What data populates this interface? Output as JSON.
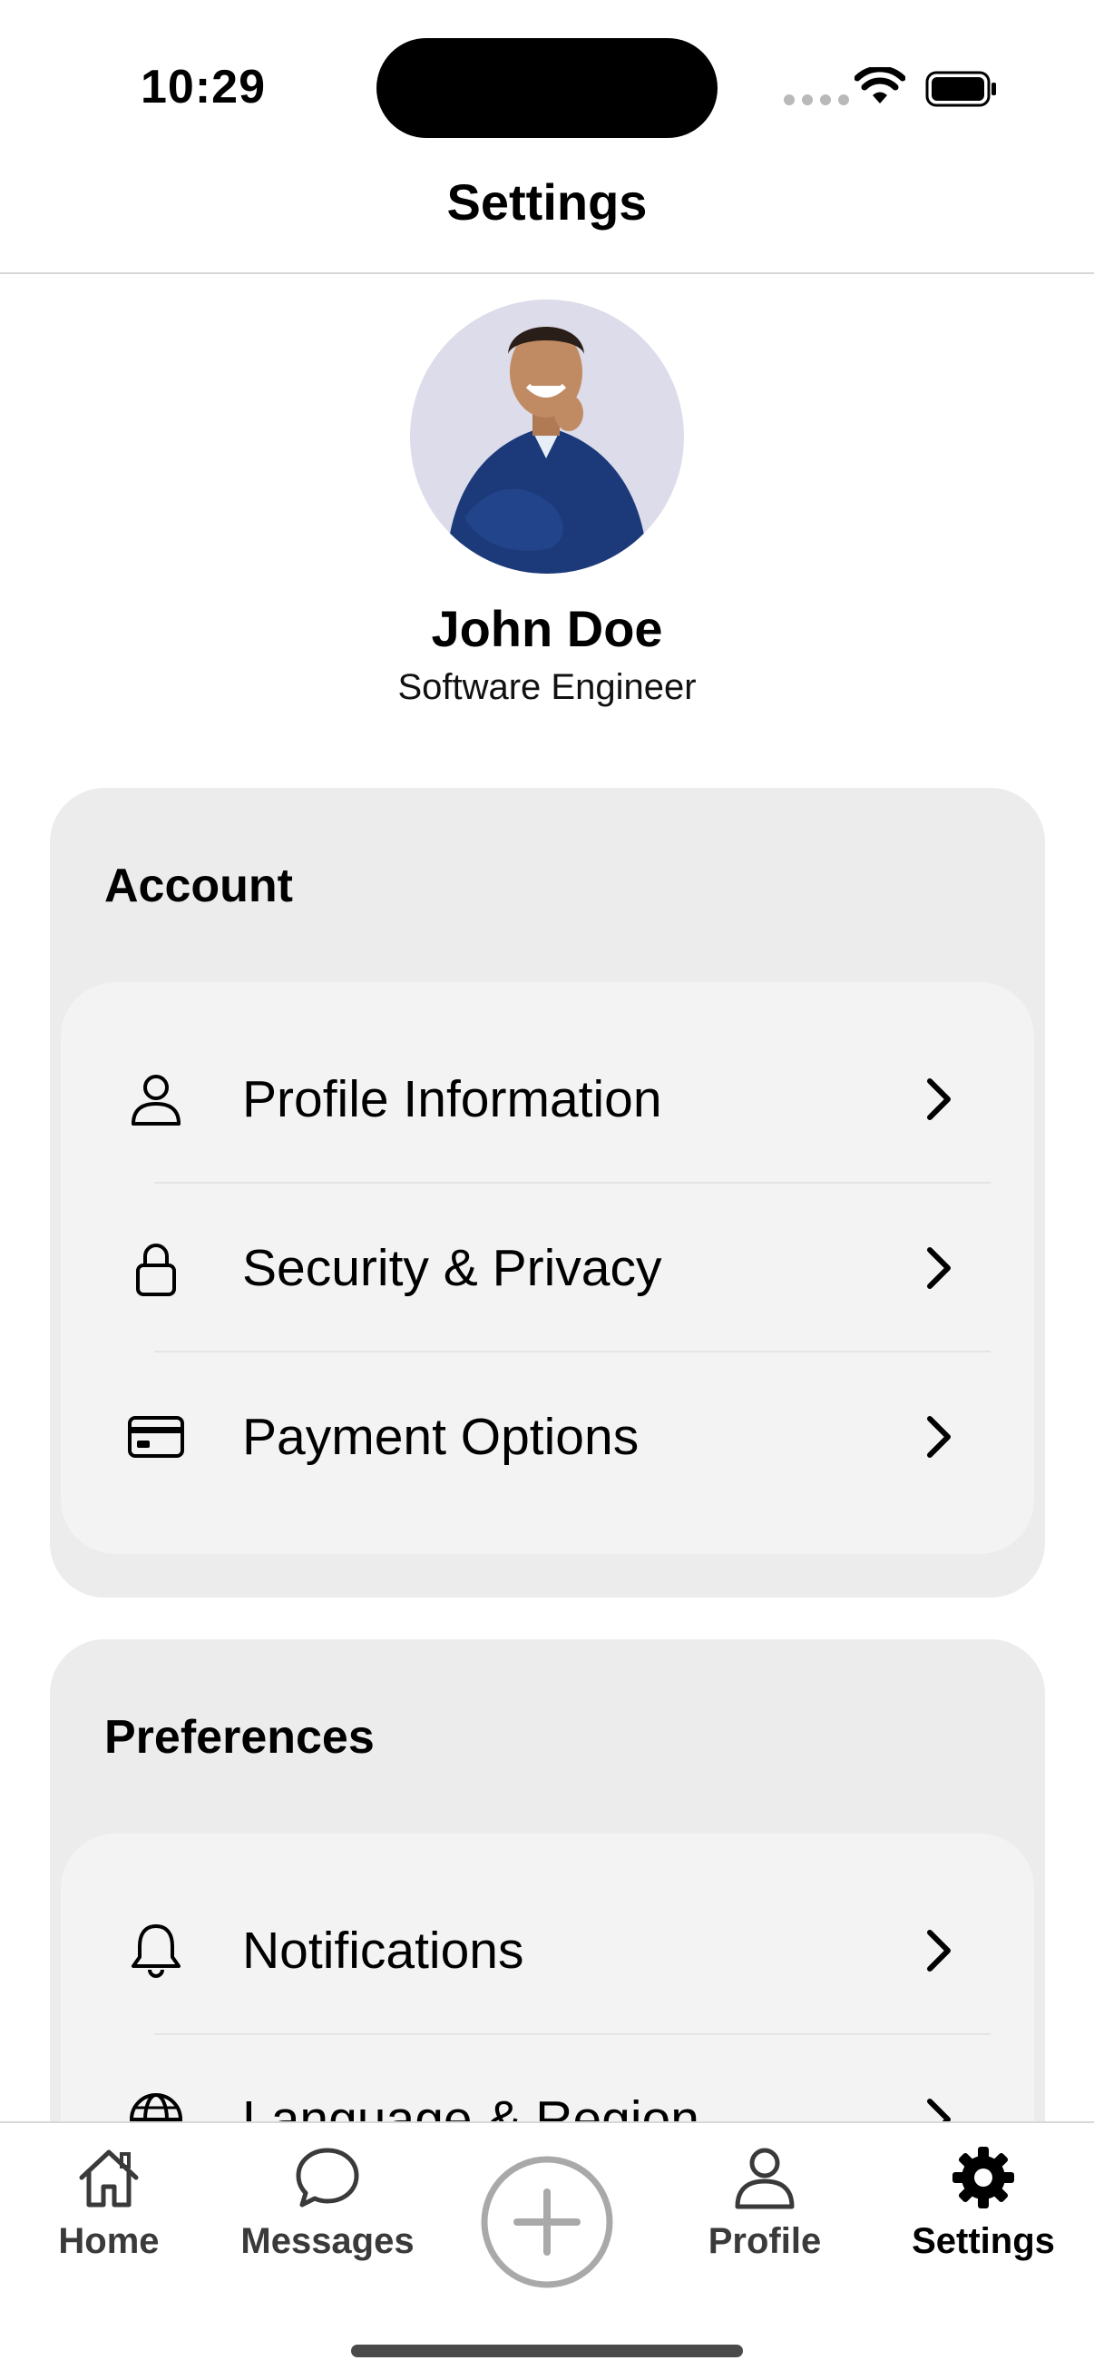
{
  "status_bar": {
    "time": "10:29",
    "signal_icon": "cellular-signal-icon",
    "wifi_icon": "wifi-icon",
    "battery_icon": "battery-icon"
  },
  "header": {
    "title": "Settings"
  },
  "profile": {
    "name": "John Doe",
    "role": "Software Engineer",
    "avatar_icon": "avatar-photo"
  },
  "sections": [
    {
      "title": "Account",
      "items": [
        {
          "label": "Profile Information",
          "icon": "person-icon"
        },
        {
          "label": "Security & Privacy",
          "icon": "lock-icon"
        },
        {
          "label": "Payment Options",
          "icon": "credit-card-icon"
        }
      ]
    },
    {
      "title": "Preferences",
      "items": [
        {
          "label": "Notifications",
          "icon": "bell-icon"
        },
        {
          "label": "Language & Region",
          "icon": "globe-icon"
        }
      ]
    }
  ],
  "tab_bar": {
    "tabs": [
      {
        "label": "Home",
        "icon": "home-icon"
      },
      {
        "label": "Messages",
        "icon": "chat-bubble-icon"
      },
      {
        "label": "Profile",
        "icon": "person-icon"
      },
      {
        "label": "Settings",
        "icon": "gear-icon"
      }
    ],
    "add_icon": "plus-circle-icon",
    "active_tab": "Settings"
  },
  "colors": {
    "card_outer": "#ececec",
    "card_inner": "#f3f3f3",
    "text": "#000000",
    "add_button": "#a9a9a9"
  }
}
